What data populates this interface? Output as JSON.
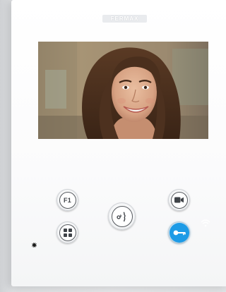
{
  "device": {
    "brand": "FERMAX",
    "buttons": {
      "f1": {
        "label": "F1",
        "icon": "f1-icon"
      },
      "menu": {
        "icon": "grid-menu-icon"
      },
      "talk": {
        "icon": "talk-icon"
      },
      "camera": {
        "icon": "camera-icon"
      },
      "door": {
        "icon": "key-icon",
        "color": "#1d9be6"
      }
    },
    "indicators": {
      "led": {
        "icon": "led-indicator-icon",
        "color": "#1b1b1b"
      },
      "wifi": {
        "icon": "wifi-icon",
        "color": "#ffffff"
      }
    }
  },
  "colors": {
    "panel": "#ffffff",
    "button_outline": "#55595e",
    "door_button": "#1d9be6"
  }
}
